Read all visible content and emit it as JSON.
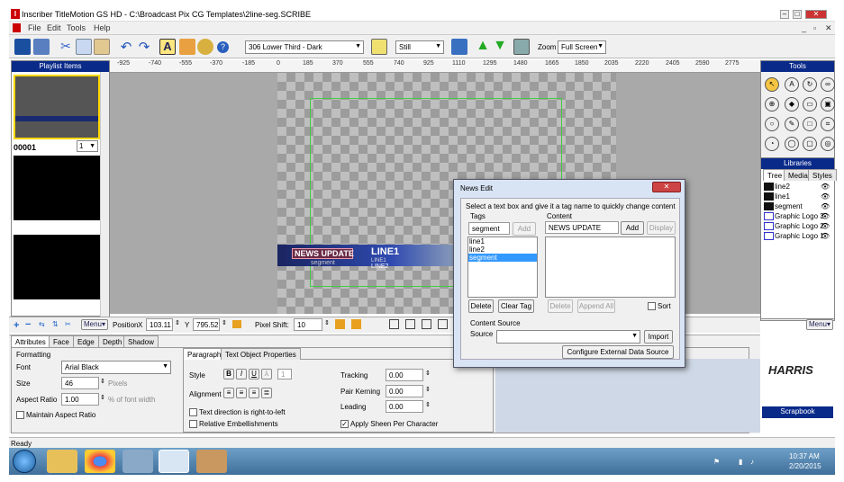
{
  "window": {
    "title": "Inscriber TitleMotion GS HD - C:\\Broadcast Pix CG Templates\\2line-seg.SCRIBE"
  },
  "menu": [
    "File",
    "Edit",
    "Tools",
    "Help"
  ],
  "toolbar": {
    "template": "306 Lower Third - Dark",
    "mode": "Still",
    "zoom_label": "Zoom",
    "zoom_value": "Full Screen"
  },
  "playlist": {
    "title": "Playlist Items",
    "item_id": "00001",
    "item_num": "1"
  },
  "ruler": [
    "-925",
    "-740",
    "-555",
    "-370",
    "-185",
    "0",
    "185",
    "370",
    "555",
    "740",
    "925",
    "1110",
    "1295",
    "1480",
    "1665",
    "1850",
    "2035",
    "2220",
    "2405",
    "2590",
    "2775"
  ],
  "canvas": {
    "news_update": "NEWS UPDATE",
    "segment": "segment",
    "line1": "LINE1",
    "line2": "LINE2",
    "line1_small": "LINE1"
  },
  "tools_panel": {
    "title": "Tools"
  },
  "libraries": {
    "title": "Libraries",
    "tabs": [
      "Tree",
      "Media",
      "Styles"
    ],
    "items": [
      "line2",
      "line1",
      "segment",
      "Graphic Logo 3",
      "Graphic Logo 2",
      "Graphic Logo 1"
    ],
    "menu": "Menu"
  },
  "brand": {
    "logo": "HARRIS"
  },
  "scrapbook": "Scrapbook",
  "position_bar": {
    "menu": "Menu",
    "position_label": "Position",
    "x_label": "X",
    "x_value": "103.11",
    "y_label": "Y",
    "y_value": "795.52",
    "pixel_shift_label": "Pixel Shift:",
    "pixel_shift_value": "10"
  },
  "props": {
    "tabs": [
      "Attributes",
      "Face",
      "Edge",
      "Depth",
      "Shadow"
    ],
    "formatting": "Formatting",
    "font_label": "Font",
    "font_value": "Arial Black",
    "size_label": "Size",
    "size_value": "46",
    "size_unit": "Pixels",
    "aspect_label": "Aspect Ratio",
    "aspect_value": "1.00",
    "aspect_unit": "% of font width",
    "maintain_aspect": "Maintain Aspect Ratio",
    "subtabs": [
      "Paragraph",
      "Text Object Properties"
    ],
    "style_label": "Style",
    "style_num": "1",
    "alignment_label": "Alignment",
    "rtl": "Text direction is right-to-left",
    "relative": "Relative Embellishments",
    "tracking_label": "Tracking",
    "tracking_value": "0.00",
    "kerning_label": "Pair Kerning",
    "kerning_value": "0.00",
    "leading_label": "Leading",
    "leading_value": "0.00",
    "sheen": "Apply Sheen Per Character"
  },
  "dialog": {
    "title": "News Edit",
    "instruction": "Select a text box and give it a tag name to quickly change content",
    "tags_label": "Tags",
    "tag_input": "segment",
    "add": "Add",
    "tags": [
      "line1",
      "line2",
      "segment"
    ],
    "selected_tag": "segment",
    "delete": "Delete",
    "clear_tag": "Clear Tag",
    "content_label": "Content",
    "content_input": "NEWS UPDATE",
    "content_add": "Add",
    "display": "Display",
    "content_delete": "Delete",
    "append_all": "Append All",
    "sort": "Sort",
    "content_source": "Content Source",
    "source_label": "Source",
    "import": "Import",
    "configure": "Configure External Data Source"
  },
  "status": "Ready",
  "clock": {
    "time": "10:37 AM",
    "date": "2/20/2015"
  }
}
